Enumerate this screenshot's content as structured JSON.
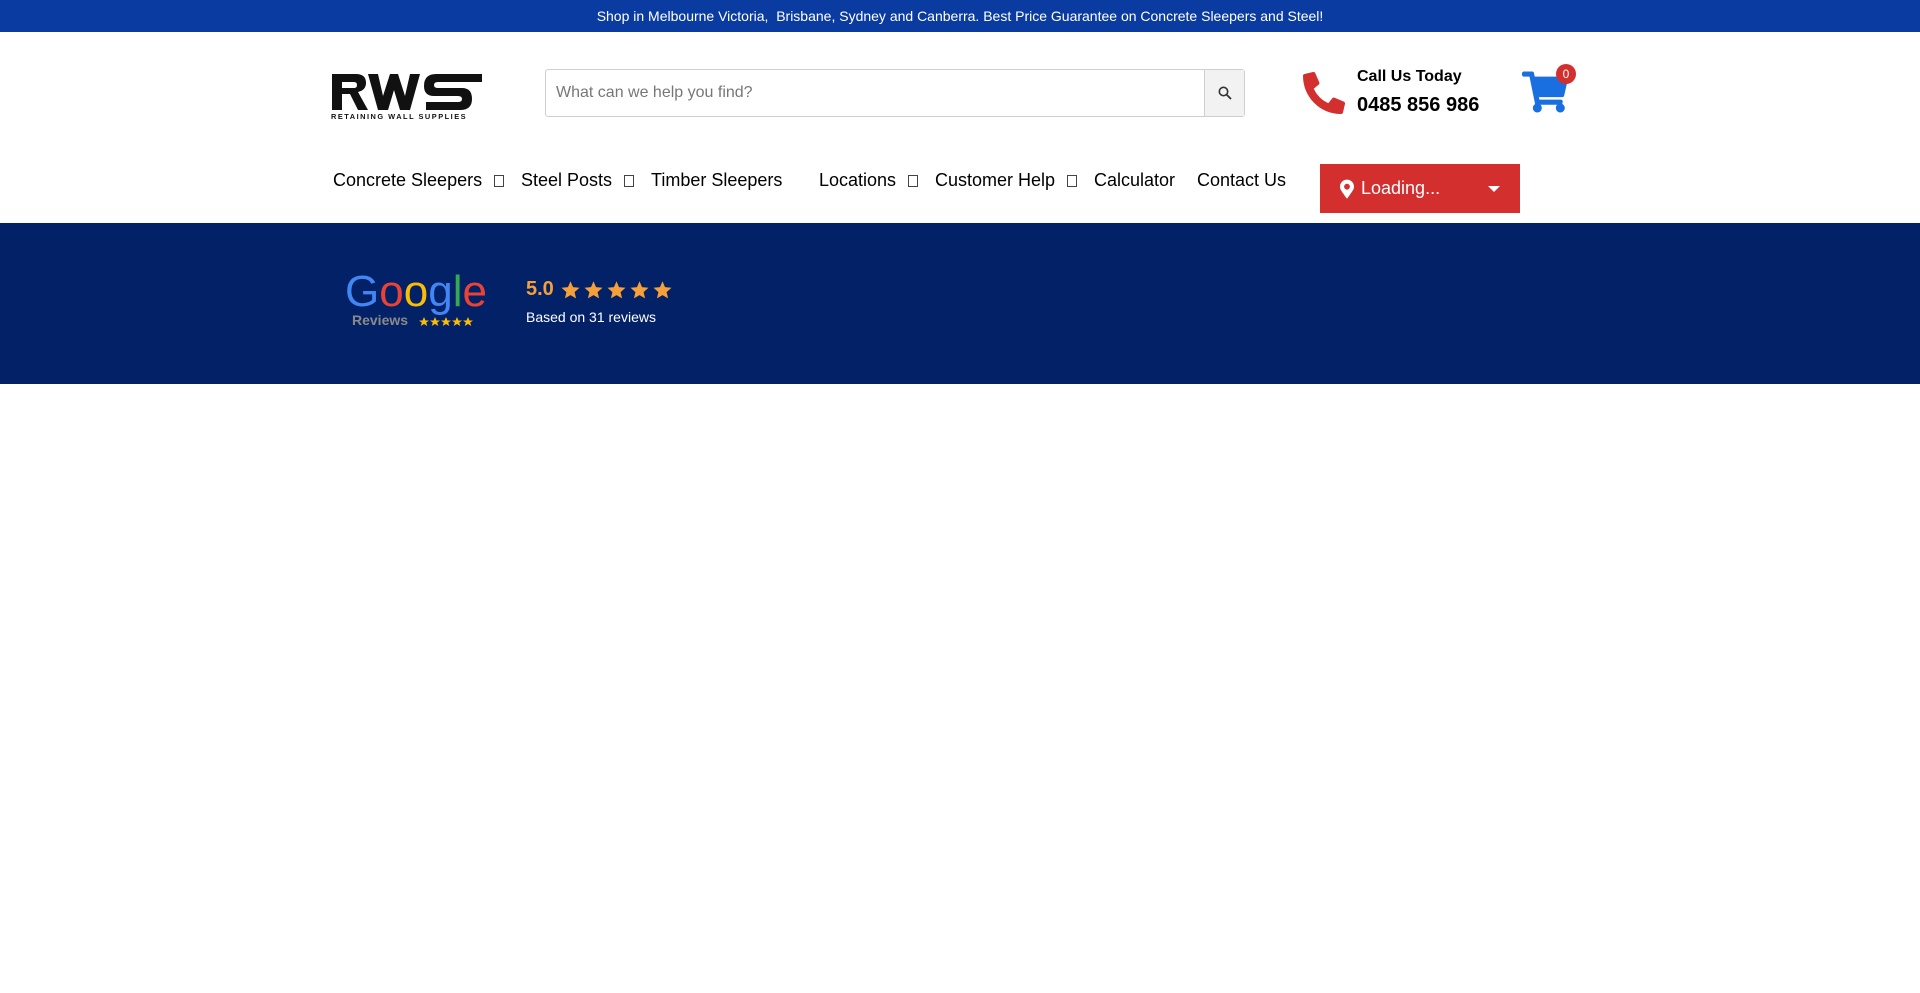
{
  "announcement": "Shop in Melbourne Victoria,  Brisbane, Sydney and Canberra. Best Price Guarantee on Concrete Sleepers and Steel!",
  "logo": {
    "text": "RWS",
    "tagline": "RETAINING WALL SUPPLIES"
  },
  "search": {
    "placeholder": "What can we help you find?",
    "value": "",
    "icon": "search-icon"
  },
  "contact": {
    "label": "Call Us Today",
    "number": "0485 856 986",
    "icon": "phone-icon",
    "icon_color": "#d32f2f"
  },
  "cart": {
    "count": "0",
    "icon": "cart-icon",
    "color": "#1a6fe0"
  },
  "nav": {
    "items": [
      {
        "label": "Concrete Sleepers",
        "dropdown": true
      },
      {
        "label": "Steel Posts",
        "dropdown": true
      },
      {
        "label": "Timber Sleepers",
        "dropdown": false
      },
      {
        "label": "Locations",
        "dropdown": true
      },
      {
        "label": "Customer Help",
        "dropdown": true
      },
      {
        "label": "Calculator",
        "dropdown": false
      },
      {
        "label": "Contact Us",
        "dropdown": false
      }
    ],
    "location_button": {
      "label": "Loading...",
      "icon": "map-pin-icon",
      "color": "#d32f2f"
    }
  },
  "reviews": {
    "brand": "Google",
    "sub": "Reviews",
    "rating": "5.0",
    "stars": 5,
    "based_on": "Based on 31 reviews",
    "star_color": "#f5a03a",
    "background": "#022166"
  },
  "colors": {
    "topbar": "#0a3ba0",
    "accent_red": "#d32f2f",
    "navy": "#022166"
  }
}
